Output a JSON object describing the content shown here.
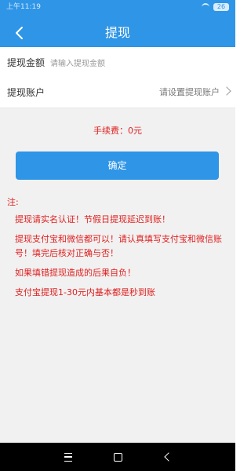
{
  "status_bar": {
    "time": "上午11:19",
    "battery": "26"
  },
  "header": {
    "title": "提现"
  },
  "form": {
    "amount_label": "提现金额",
    "amount_placeholder": "请输入提现金额",
    "amount_value": "",
    "account_label": "提现账户",
    "account_value": "请设置提现账户"
  },
  "fee": "手续费：0元",
  "confirm_label": "确定",
  "notes": {
    "title": "注:",
    "items": [
      "提现请实名认证！节假日提现延迟到账！",
      "提现支付宝和微信都可以！请认真填写支付宝和微信账号！填完后核对正确与否！",
      "如果填错提现造成的后果自负！",
      "支付宝提现1-30元内基本都是秒到账"
    ]
  },
  "colors": {
    "primary": "#2f95e6",
    "warning": "#e02020",
    "background": "#f1f1f1"
  }
}
